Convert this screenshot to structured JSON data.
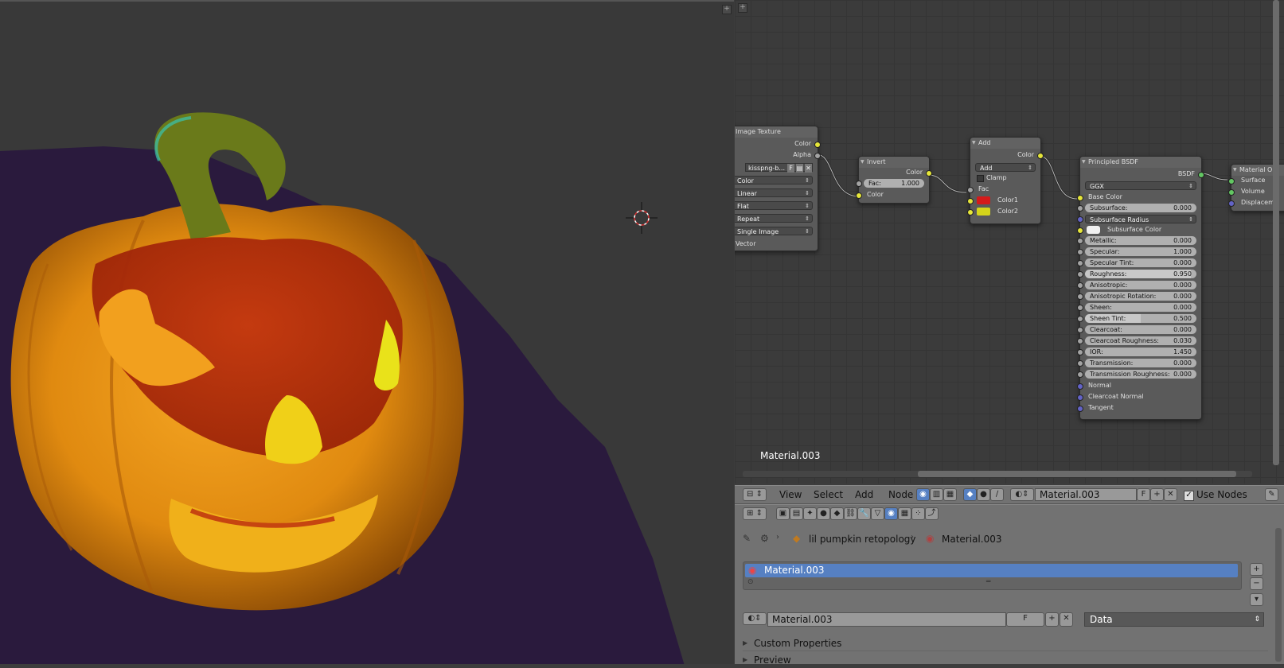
{
  "viewport": {
    "label": "3D Viewport"
  },
  "node_editor": {
    "nodes": {
      "image_texture": {
        "title": "Image Texture",
        "out_color": "Color",
        "out_alpha": "Alpha",
        "image_name": "kisspng-b...",
        "image_f": "F",
        "opt_color": "Color",
        "opt_interp": "Linear",
        "opt_proj": "Flat",
        "opt_ext": "Repeat",
        "opt_source": "Single Image",
        "in_vector": "Vector"
      },
      "invert": {
        "title": "Invert",
        "out_color": "Color",
        "fac_label": "Fac:",
        "fac_value": "1.000",
        "in_color": "Color"
      },
      "add": {
        "title": "Add",
        "out_color": "Color",
        "blend": "Add",
        "clamp": "Clamp",
        "fac": "Fac",
        "color1": "Color1",
        "color2": "Color2",
        "color1_hex": "#d41a1a",
        "color2_hex": "#d4d41a"
      },
      "principled": {
        "title": "Principled BSDF",
        "out": "BSDF",
        "distribution": "GGX",
        "base_color": "Base Color",
        "subsurface_method": "Subsurface Radius",
        "subsurface_color": "Subsurface Color",
        "fields": [
          {
            "label": "Subsurface:",
            "value": "0.000"
          },
          {
            "label": "Metallic:",
            "value": "0.000"
          },
          {
            "label": "Specular:",
            "value": "1.000"
          },
          {
            "label": "Specular Tint:",
            "value": "0.000"
          },
          {
            "label": "Roughness:",
            "value": "0.950"
          },
          {
            "label": "Anisotropic:",
            "value": "0.000"
          },
          {
            "label": "Anisotropic Rotation:",
            "value": "0.000"
          },
          {
            "label": "Sheen:",
            "value": "0.000"
          },
          {
            "label": "Sheen Tint:",
            "value": "0.500"
          },
          {
            "label": "Clearcoat:",
            "value": "0.000"
          },
          {
            "label": "Clearcoat Roughness:",
            "value": "0.030"
          },
          {
            "label": "IOR:",
            "value": "1.450"
          },
          {
            "label": "Transmission:",
            "value": "0.000"
          },
          {
            "label": "Transmission Roughness:",
            "value": "0.000"
          }
        ],
        "normal": "Normal",
        "clearcoat_normal": "Clearcoat Normal",
        "tangent": "Tangent"
      },
      "material_output": {
        "title": "Material Ou",
        "surface": "Surface",
        "volume": "Volume",
        "displacement": "Displaceme"
      }
    },
    "material_label": "Material.003"
  },
  "node_header": {
    "menu_view": "View",
    "menu_select": "Select",
    "menu_add": "Add",
    "menu_node": "Node",
    "material_name": "Material.003",
    "f_label": "F",
    "use_nodes": "Use Nodes"
  },
  "properties": {
    "breadcrumb_object": "lil pumpkin retopology",
    "breadcrumb_material": "Material.003",
    "slot_name": "Material.003",
    "datablock_name": "Material.003",
    "f_label": "F",
    "link_mode": "Data",
    "panel_custom": "Custom Properties",
    "panel_preview": "Preview"
  }
}
